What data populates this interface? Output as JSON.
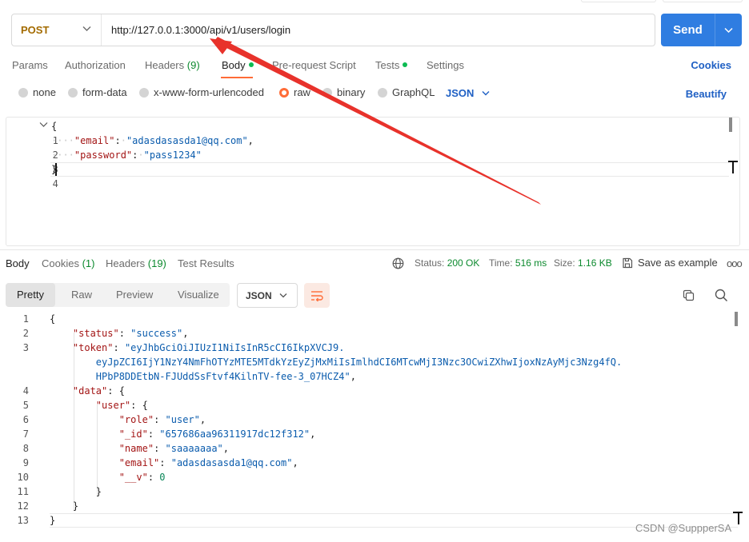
{
  "request": {
    "method": "POST",
    "url": "http://127.0.0.1:3000/api/v1/users/login",
    "send_label": "Send",
    "tabs": [
      {
        "label": "Params"
      },
      {
        "label": "Authorization"
      },
      {
        "label": "Headers",
        "count": "(9)"
      },
      {
        "label": "Body"
      },
      {
        "label": "Pre-request Script"
      },
      {
        "label": "Tests"
      },
      {
        "label": "Settings"
      }
    ],
    "cookies_label": "Cookies",
    "body_types": [
      "none",
      "form-data",
      "x-www-form-urlencoded",
      "raw",
      "binary",
      "GraphQL"
    ],
    "selected_body_type": "raw",
    "format": "JSON",
    "beautify_label": "Beautify",
    "line_numbers": [
      "1",
      "2",
      "3",
      "4"
    ],
    "body": {
      "brace_open": "{",
      "email_key": "\"email\"",
      "email_value": "\"adasdasasda1@qq.com\"",
      "password_key": "\"password\"",
      "password_value": "\"pass1234\"",
      "brace_close": "}"
    }
  },
  "response": {
    "tabs": [
      {
        "label": "Body"
      },
      {
        "label": "Cookies",
        "count": "(1)"
      },
      {
        "label": "Headers",
        "count": "(19)"
      },
      {
        "label": "Test Results"
      }
    ],
    "status_label": "Status:",
    "status_value": "200 OK",
    "time_label": "Time:",
    "time_value": "516 ms",
    "size_label": "Size:",
    "size_value": "1.16 KB",
    "save_example_label": "Save as example",
    "more_label": "ooo",
    "views": [
      "Pretty",
      "Raw",
      "Preview",
      "Visualize"
    ],
    "active_view": "Pretty",
    "format": "JSON",
    "line_numbers": [
      "1",
      "2",
      "3",
      "4",
      "5",
      "6",
      "7",
      "8",
      "9",
      "10",
      "11",
      "12",
      "13"
    ],
    "json": {
      "status_key": "\"status\"",
      "status_value": "\"success\"",
      "token_key": "\"token\"",
      "token_line1": "\"eyJhbGciOiJIUzI1NiIsInR5cCI6IkpXVCJ9.",
      "token_line2": "eyJpZCI6IjY1NzY4NmFhOTYzMTE5MTdkYzEyZjMxMiIsImlhdCI6MTcwMjI3Nzc3OCwiZXhwIjoxNzAyMjc3Nzg4fQ.",
      "token_line3": "HPbP8DDEtbN-FJUddSsFtvf4KilnTV-fee-3_07HCZ4\"",
      "data_key": "\"data\"",
      "user_key": "\"user\"",
      "role_key": "\"role\"",
      "role_value": "\"user\"",
      "id_key": "\"_id\"",
      "id_value": "\"657686aa96311917dc12f312\"",
      "name_key": "\"name\"",
      "name_value": "\"saaaaaaa\"",
      "email_key": "\"email\"",
      "email_value": "\"adasdasasda1@qq.com\"",
      "v_key": "\"__v\"",
      "v_value": "0"
    }
  },
  "watermark": "CSDN @SuppperSA",
  "colors": {
    "accent": "#ff6c37",
    "send": "#2f7de1",
    "link": "#1f60c4",
    "status_ok": "#0c8a2e",
    "annotation_arrow": "#e8322b"
  },
  "icons": [
    "chevron-down-icon",
    "fold-chevron-icon",
    "globe-icon",
    "save-icon",
    "more-icon",
    "wrap-lines-icon",
    "copy-icon",
    "search-icon",
    "arrow-annotation"
  ]
}
